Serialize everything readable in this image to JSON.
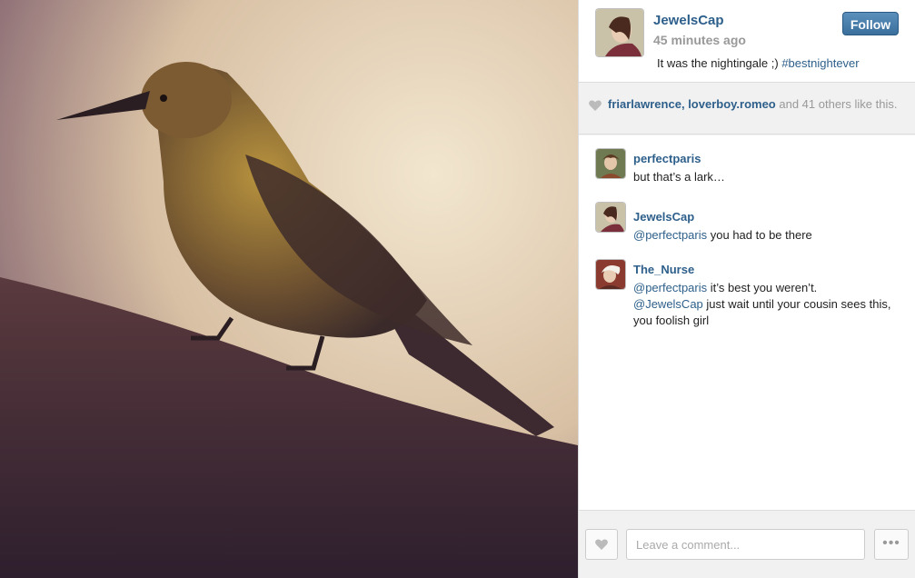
{
  "photo": {
    "icon": "bird-photo"
  },
  "post": {
    "author": "JewelsCap",
    "time": "45 minutes ago",
    "follow_label": "Follow",
    "caption_text": "It was the nightingale ;)",
    "caption_hashtag": "#bestnightever"
  },
  "likes": {
    "user1": "friarlawrence",
    "separator": ",",
    "user2": "loverboy.romeo",
    "rest": "and 41 others like this."
  },
  "comments": [
    {
      "author": "perfectparis",
      "text": "but that’s a lark…"
    },
    {
      "author": "JewelsCap",
      "mention": "@perfectparis",
      "text": "you had to be there"
    },
    {
      "author": "The_Nurse",
      "mention1": "@perfectparis",
      "text1": "it’s best you weren’t.",
      "mention2": "@JewelsCap",
      "text2": "just wait until your cousin sees this, you foolish girl"
    }
  ],
  "footer": {
    "comment_placeholder": "Leave a comment...",
    "more_label": "•••"
  },
  "colors": {
    "accent": "#2d5f8a",
    "follow_bg": "#3b6f9c",
    "muted": "#999999"
  }
}
